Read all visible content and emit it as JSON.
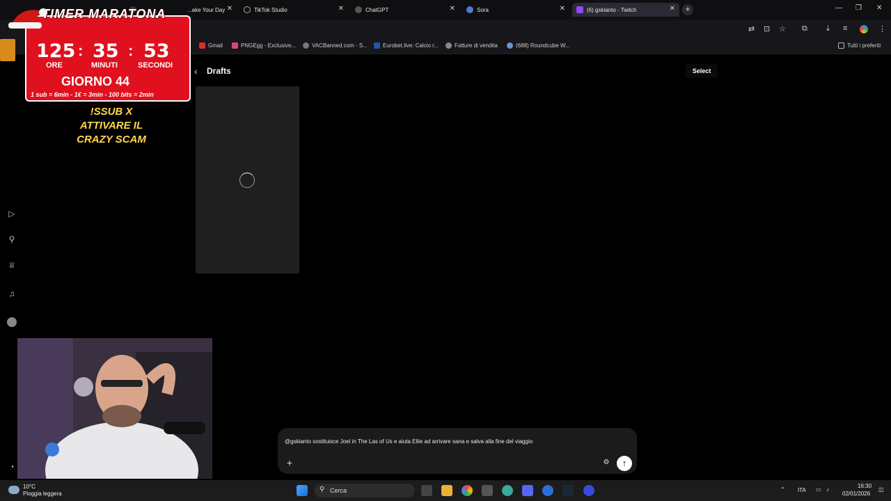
{
  "browser": {
    "tabs": [
      {
        "title": "TIMER MARATONA",
        "icon_color": "#d02020"
      },
      {
        "title": "...ake Your Day",
        "icon_color": "#333333"
      },
      {
        "title": "TikTok Studio",
        "icon_color": "#111111"
      },
      {
        "title": "ChatGPT",
        "icon_color": "#555555"
      },
      {
        "title": "Sora",
        "icon_color": "#4a7bd4"
      },
      {
        "title": "(6) gskianto - Twitch",
        "icon_color": "#9146ff"
      }
    ],
    "new_tab": "+",
    "bookmarks": [
      {
        "label": "Gmail",
        "icon_color": "#d93025"
      },
      {
        "label": "PNGEgg - Exclusive...",
        "icon_color": "#e04080"
      },
      {
        "label": "VACBanned.com - S...",
        "icon_color": "#777777"
      },
      {
        "label": "Eurobet.live: Calcio r...",
        "icon_color": "#2255aa"
      },
      {
        "label": "Fatture di vendita",
        "icon_color": "#888888"
      },
      {
        "label": "(688) Roundcube W...",
        "icon_color": "#6699cc"
      }
    ],
    "all_bookmarks": "Tutti i preferiti"
  },
  "page": {
    "title": "Drafts",
    "select_label": "Select"
  },
  "overlay": {
    "timer_title": "TIMER MARATONA",
    "hours": "125",
    "minutes": "35",
    "seconds": "53",
    "hours_label": "ORE",
    "minutes_label": "MINUTI",
    "seconds_label": "SECONDI",
    "day_label": "GIORNO 44",
    "rates": "1 sub = 6min - 1€ = 3min - 100 bits = 2min",
    "promo_lines": [
      "!SSUB X",
      "ATTIVARE IL",
      "CRAZY SCAM"
    ]
  },
  "composer": {
    "prompt": "@gskianto  sostituisce Joel in The Las of Us e aiuta Ellie ad arrivare sana e salva alla fine del viaggio",
    "plus": "+",
    "send": "↑"
  },
  "taskbar": {
    "temperature": "10°C",
    "weather": "Pioggia leggera",
    "search_label": "Cerca",
    "language": "ITA",
    "time": "16:30",
    "date": "02/01/2026"
  },
  "colors": {
    "timer_red": "#e0101e",
    "promo_yellow": "#ffd84a",
    "twitch_purple": "#9146ff"
  }
}
